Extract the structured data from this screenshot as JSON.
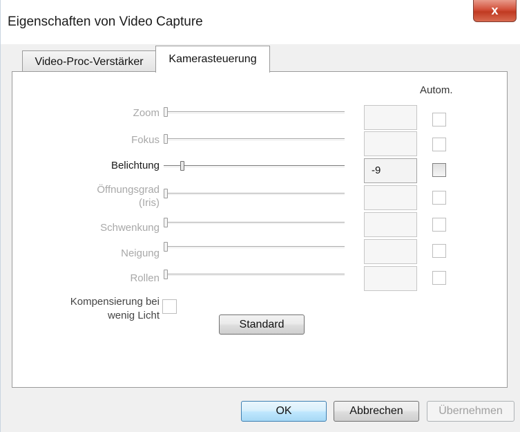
{
  "window": {
    "title": "Eigenschaften von Video Capture",
    "close_symbol": "x"
  },
  "tabs": [
    {
      "label": "Video-Proc-Verstärker",
      "selected": false
    },
    {
      "label": "Kamerasteuerung",
      "selected": true
    }
  ],
  "camera": {
    "autom_header": "Autom.",
    "rows": [
      {
        "label": "Zoom",
        "value": "",
        "enabled": false,
        "slider_fraction": 0.0,
        "auto_checked": false
      },
      {
        "label": "Fokus",
        "value": "",
        "enabled": false,
        "slider_fraction": 0.0,
        "auto_checked": false
      },
      {
        "label": "Belichtung",
        "value": "-9",
        "enabled": true,
        "slider_fraction": 0.1,
        "auto_checked": false
      },
      {
        "label": "Öffnungsgrad\n(Iris)",
        "label_line1": "Öffnungsgrad",
        "label_line2": "(Iris)",
        "value": "",
        "enabled": false,
        "slider_fraction": 0.0,
        "auto_checked": false
      },
      {
        "label": "Schwenkung",
        "value": "",
        "enabled": false,
        "slider_fraction": 0.0,
        "auto_checked": false
      },
      {
        "label": "Neigung",
        "value": "",
        "enabled": false,
        "slider_fraction": 0.0,
        "auto_checked": false
      },
      {
        "label": "Rollen",
        "value": "",
        "enabled": false,
        "slider_fraction": 0.0,
        "auto_checked": false
      }
    ],
    "lowlight_label_line1": "Kompensierung bei",
    "lowlight_label_line2": "wenig Licht",
    "standard_label": "Standard"
  },
  "buttons": {
    "ok": "OK",
    "cancel": "Abbrechen",
    "apply": "Übernehmen"
  }
}
